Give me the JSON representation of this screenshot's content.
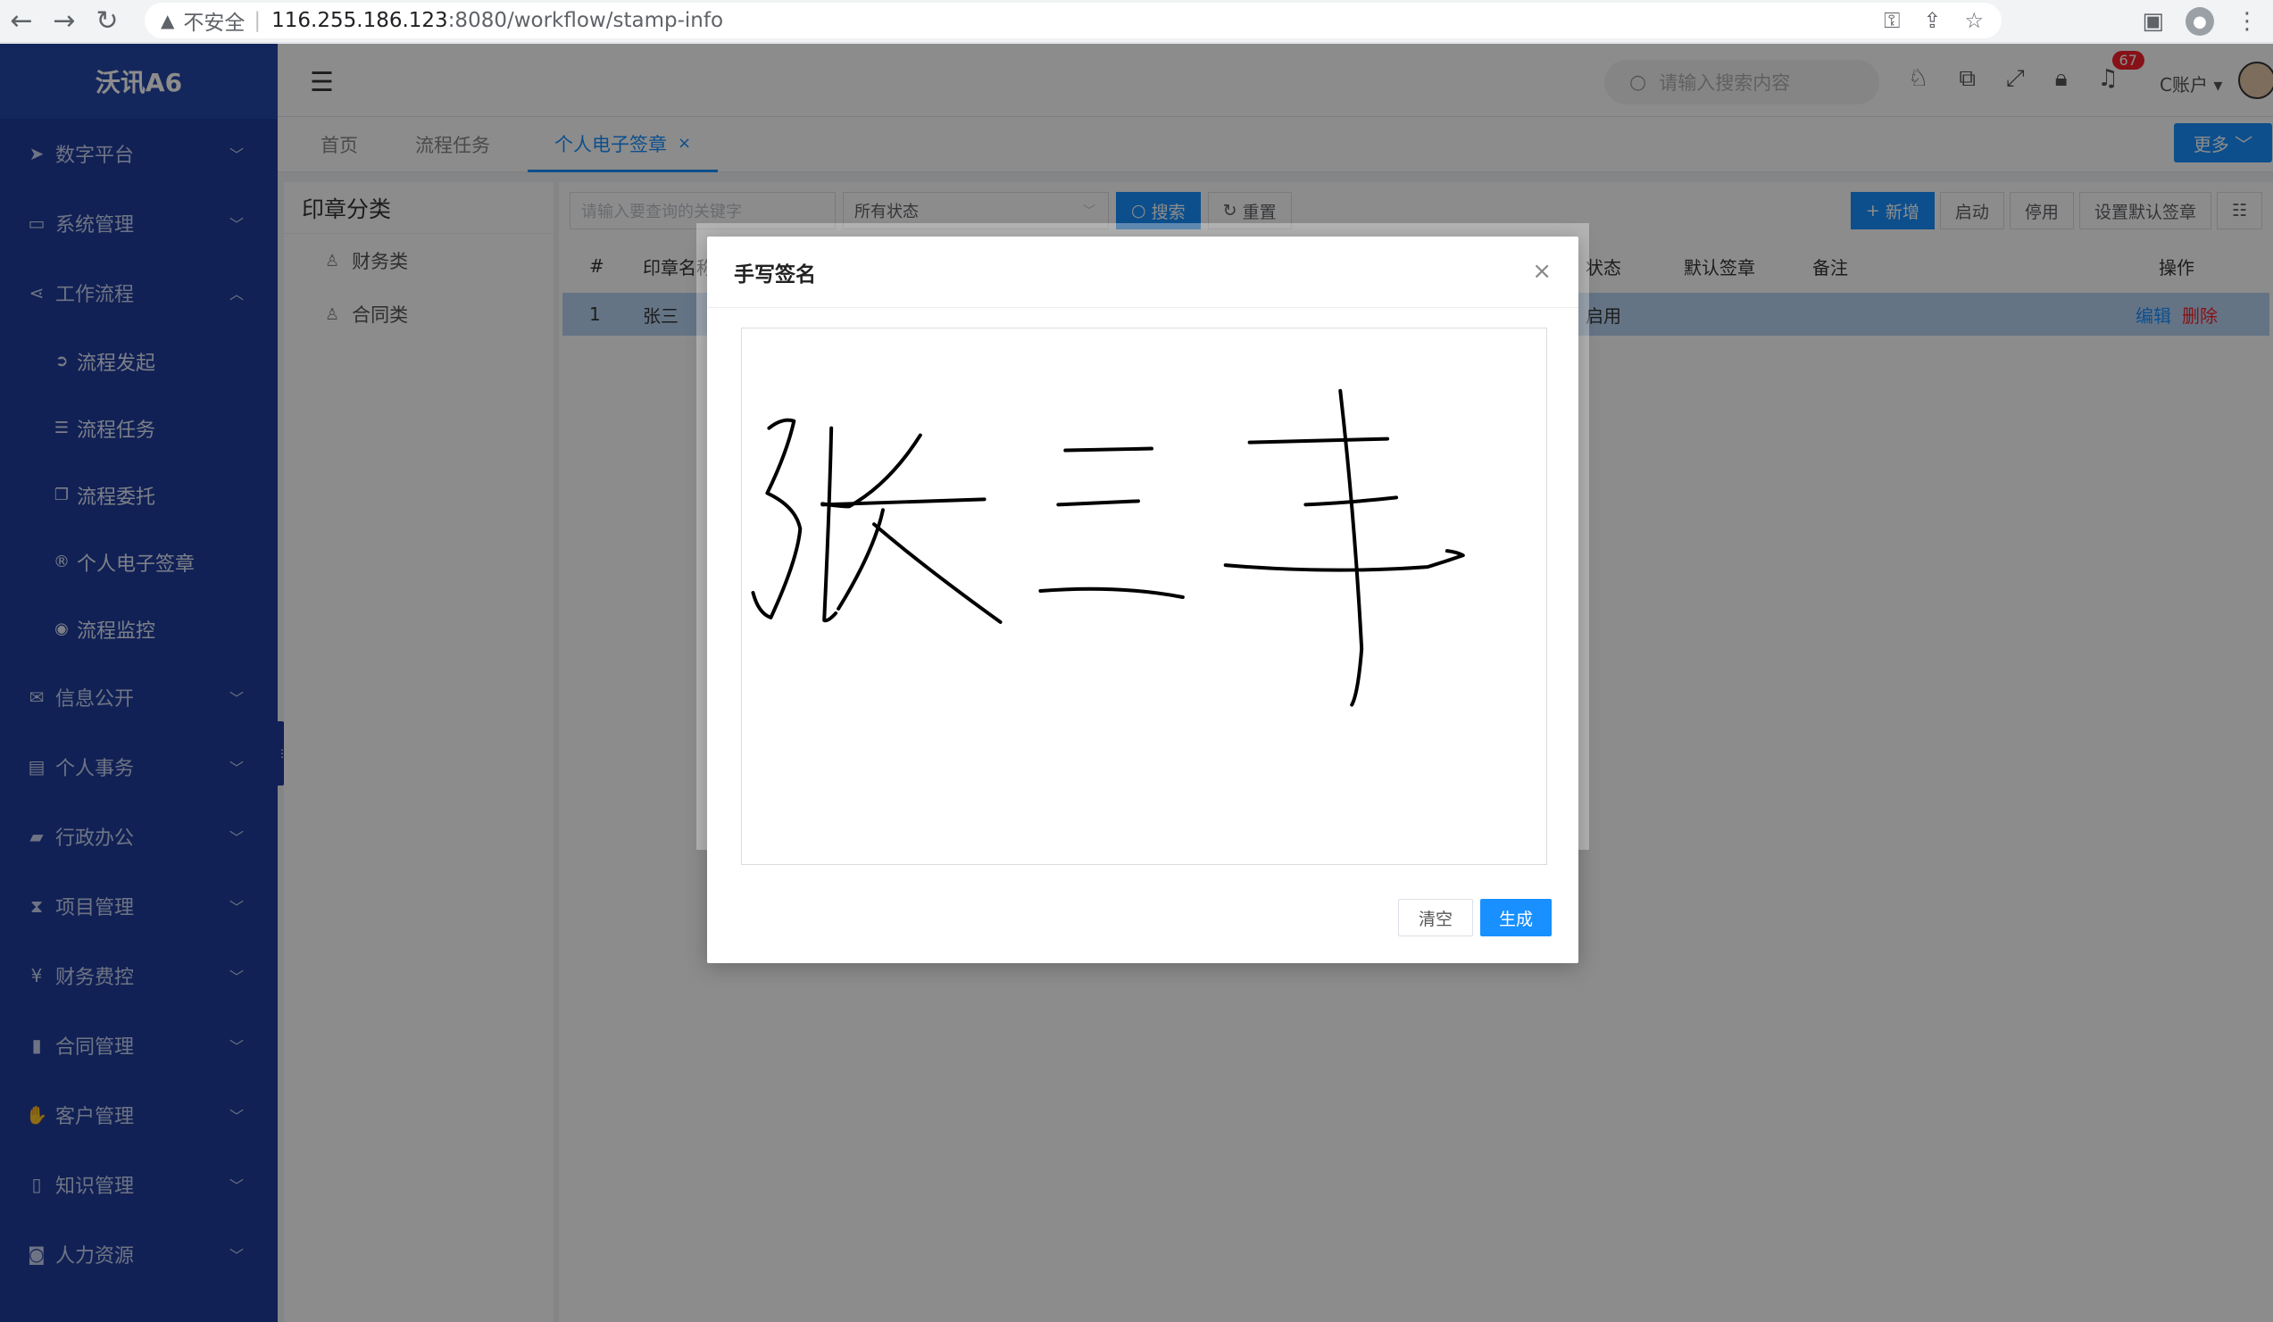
{
  "browser": {
    "insecure_label": "不安全",
    "url_host": "116.255.186.123",
    "url_path": ":8080/workflow/stamp-info"
  },
  "sidebar": {
    "logo": "沃讯A6",
    "items": [
      {
        "label": "数字平台",
        "icon": "paper-plane-icon"
      },
      {
        "label": "系统管理",
        "icon": "monitor-icon"
      },
      {
        "label": "工作流程",
        "icon": "share-icon"
      },
      {
        "label": "信息公开",
        "icon": "chat-icon"
      },
      {
        "label": "个人事务",
        "icon": "id-card-icon"
      },
      {
        "label": "行政办公",
        "icon": "briefcase-icon"
      },
      {
        "label": "项目管理",
        "icon": "hourglass-icon"
      },
      {
        "label": "财务费控",
        "icon": "yen-icon"
      },
      {
        "label": "合同管理",
        "icon": "file-icon"
      },
      {
        "label": "客户管理",
        "icon": "handshake-icon"
      },
      {
        "label": "知识管理",
        "icon": "book-icon"
      },
      {
        "label": "人力资源",
        "icon": "user-badge-icon"
      }
    ],
    "sub_items": [
      {
        "label": "流程发起",
        "icon": "arrow-circle-icon"
      },
      {
        "label": "流程任务",
        "icon": "list-icon"
      },
      {
        "label": "流程委托",
        "icon": "copy-icon"
      },
      {
        "label": "个人电子签章",
        "icon": "registered-icon"
      },
      {
        "label": "流程监控",
        "icon": "eye-icon"
      }
    ]
  },
  "header": {
    "search_placeholder": "请输入搜索内容",
    "notification_count": "67",
    "account_label": "C账户"
  },
  "tabs": {
    "items": [
      {
        "label": "首页"
      },
      {
        "label": "流程任务"
      },
      {
        "label": "个人电子签章"
      }
    ],
    "more_label": "更多"
  },
  "left_panel": {
    "title": "印章分类",
    "nodes": [
      "财务类",
      "合同类"
    ]
  },
  "toolbar": {
    "keyword_placeholder": "请输入要查询的关键字",
    "status_select": "所有状态",
    "search_label": "搜索",
    "reset_label": "重置",
    "add_label": "新增",
    "enable_label": "启动",
    "disable_label": "停用",
    "set_default_label": "设置默认签章"
  },
  "table": {
    "headers": {
      "index": "#",
      "name": "印章名称",
      "status": "状态",
      "default": "默认签章",
      "remark": "备注",
      "actions": "操作"
    },
    "rows": [
      {
        "index": "1",
        "name": "张三",
        "status": "启用",
        "edit": "编辑",
        "delete": "删除"
      }
    ]
  },
  "modal": {
    "title": "手写签名",
    "clear_label": "清空",
    "generate_label": "生成"
  }
}
